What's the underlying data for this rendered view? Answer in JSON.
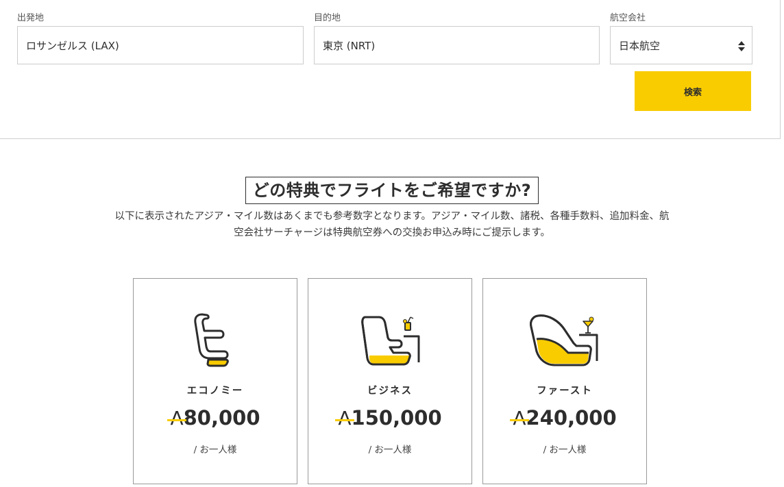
{
  "search": {
    "origin_label": "出発地",
    "origin_value": "ロサンゼルス (LAX)",
    "destination_label": "目的地",
    "destination_value": "東京 (NRT)",
    "airline_label": "航空会社",
    "airline_value": "日本航空",
    "search_button": "検索"
  },
  "section": {
    "heading": "どの特典でフライトをご希望ですか?",
    "description_line1": "以下に表示されたアジア・マイル数はあくまでも参考数字となります。アジア・マイル数、諸税、各種手数料、追加料金、航",
    "description_line2": "空会社サーチャージは特典航空券への交換お申込み時にご提示します。"
  },
  "cards": [
    {
      "cabin": "エコノミー",
      "symbol": "A",
      "miles": "80,000",
      "per_person": "/ お一人様",
      "icon": "economy-seat-icon"
    },
    {
      "cabin": "ビジネス",
      "symbol": "A",
      "miles": "150,000",
      "per_person": "/ お一人様",
      "icon": "business-seat-icon"
    },
    {
      "cabin": "ファースト",
      "symbol": "A",
      "miles": "240,000",
      "per_person": "/ お一人様",
      "icon": "first-seat-icon"
    }
  ],
  "colors": {
    "accent": "#f9cc00",
    "text": "#2d2d2d",
    "border": "#cccccc"
  }
}
